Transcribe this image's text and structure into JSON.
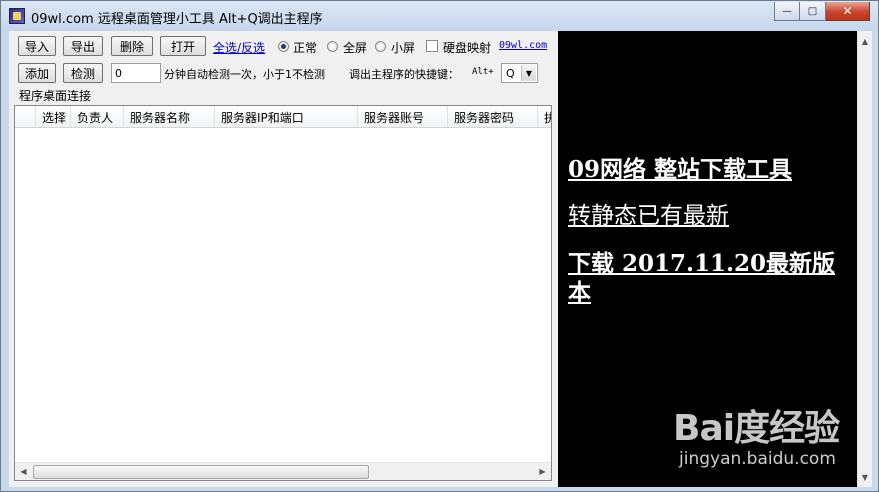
{
  "window": {
    "title": "09wl.com 远程桌面管理小工具 Alt+Q调出主程序",
    "controls": {
      "minimize": "—",
      "maximize": "□",
      "close": "✕"
    }
  },
  "toolbar": {
    "import_label": "导入",
    "export_label": "导出",
    "delete_label": "删除",
    "open_label": "打开",
    "select_all_link": "全选/反选",
    "mode_normal": "正常",
    "mode_fullscreen": "全屏",
    "mode_small": "小屏",
    "mode_selected": "正常",
    "disk_mapping_label": "硬盘映射",
    "disk_mapping_checked": false,
    "site_link": "09wl.com",
    "add_label": "添加",
    "check_label": "检测",
    "interval_value": "0",
    "interval_text": "分钟自动检测一次，小于1不检测",
    "hotkey_label": "调出主程序的快捷键：",
    "hotkey_prefix": "Alt+",
    "hotkey_value": "Q"
  },
  "connections": {
    "group_label": "程序桌面连接",
    "columns": [
      "选择",
      "负责人",
      "服务器名称",
      "服务器IP和端口",
      "服务器账号",
      "服务器密码",
      "执"
    ],
    "rows": []
  },
  "promo": {
    "line1": "09网络 整站下载工具",
    "line2": "转静态已有最新",
    "line3": "下载 2017.11.20最新版本"
  },
  "watermark": {
    "logo": "Bai度经验",
    "url": "jingyan.baidu.com"
  },
  "colors": {
    "link": "#0000cc",
    "promo_bg": "#000000",
    "promo_text": "#ffffff",
    "close_button": "#c8452c"
  }
}
